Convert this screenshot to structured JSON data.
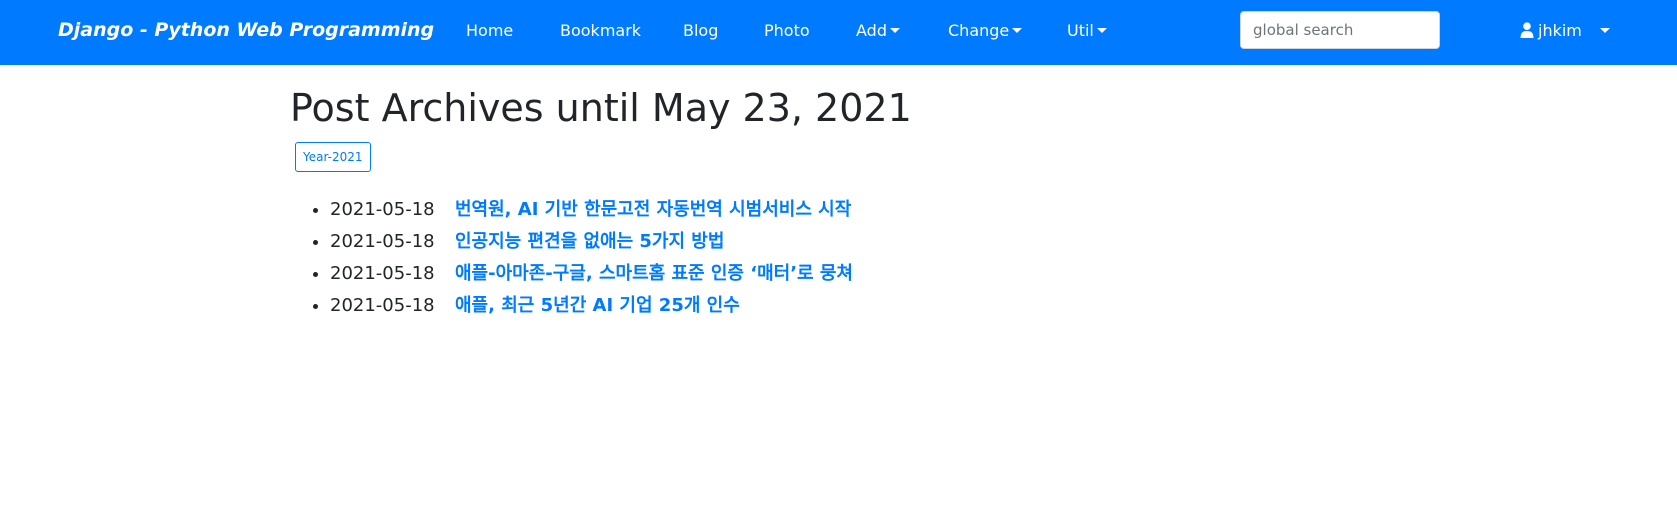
{
  "navbar": {
    "brand": "Django - Python Web Programming",
    "items": [
      {
        "label": "Home"
      },
      {
        "label": "Bookmark"
      },
      {
        "label": "Blog"
      },
      {
        "label": "Photo"
      },
      {
        "label": "Add",
        "dropdown": true
      },
      {
        "label": "Change",
        "dropdown": true
      },
      {
        "label": "Util",
        "dropdown": true
      }
    ],
    "search": {
      "placeholder": "global search",
      "value": ""
    },
    "user": {
      "name": "jhkim",
      "icon": "user-icon"
    },
    "color": "#007bff"
  },
  "page": {
    "title": "Post Archives until May 23, 2021",
    "year_button": "Year-2021"
  },
  "posts": [
    {
      "date": "2021-05-18",
      "title": "번역원, AI 기반 한문고전 자동번역 시범서비스 시작"
    },
    {
      "date": "2021-05-18",
      "title": "인공지능 편견을 없애는 5가지 방법"
    },
    {
      "date": "2021-05-18",
      "title": "애플-아마존-구글, 스마트홈 표준 인증 ‘매터’로 뭉쳐"
    },
    {
      "date": "2021-05-18",
      "title": "애플, 최근 5년간 AI 기업 25개 인수"
    }
  ]
}
